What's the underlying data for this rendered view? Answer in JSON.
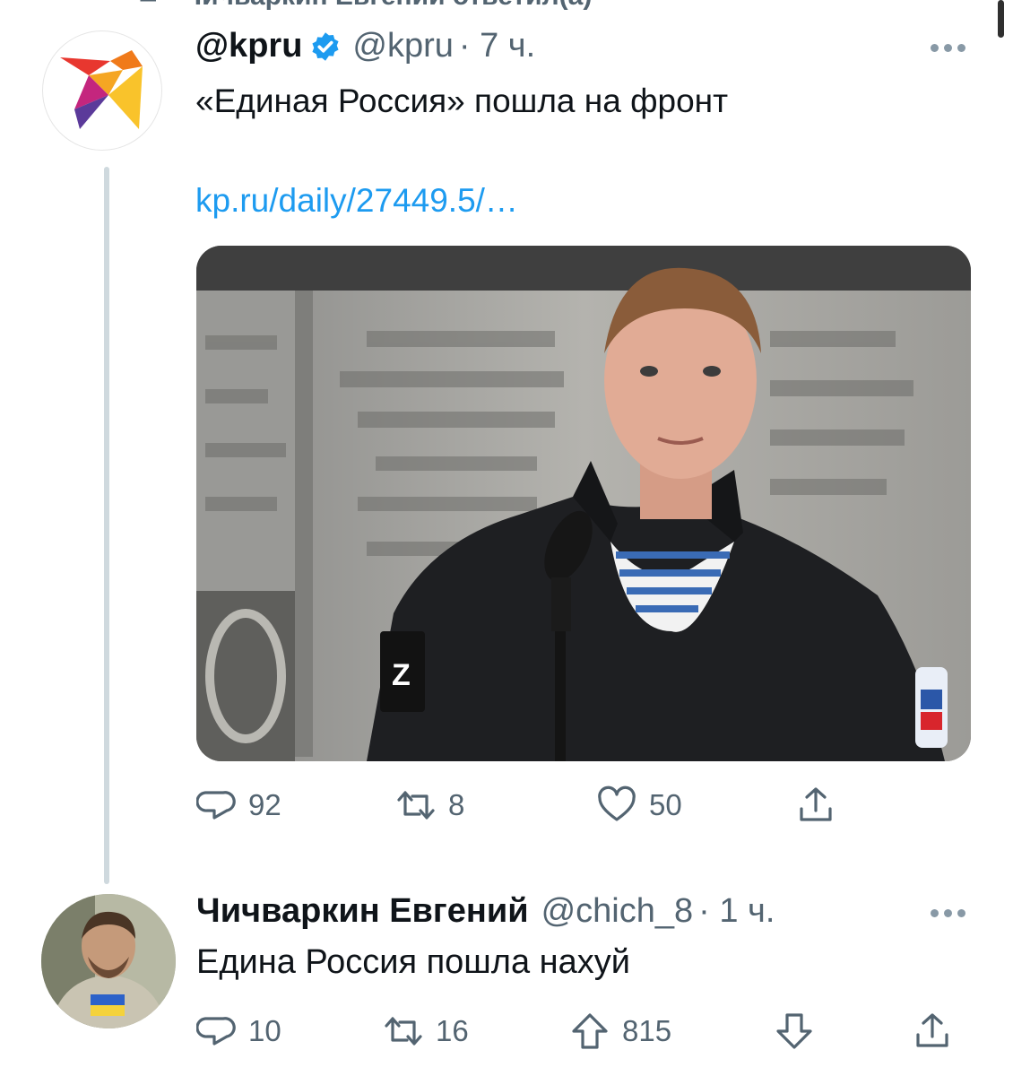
{
  "reply_header": {
    "text": "Чичваркин Евгений ответил(а)"
  },
  "tweets": [
    {
      "name": "@kpru",
      "handle": "@kpru",
      "time": "· 7 ч.",
      "text": "«Единая Россия» пошла на фронт",
      "link": "kp.ru/daily/27449.5/…",
      "stats": {
        "replies": "92",
        "retweets": "8",
        "likes": "50"
      }
    },
    {
      "name": "Чичваркин Евгений",
      "handle": "@chich_8",
      "time": "· 1 ч.",
      "text": "Едина Россия пошла нахуй",
      "stats": {
        "replies": "10",
        "retweets": "16",
        "upvotes": "815"
      }
    }
  ],
  "colors": {
    "link": "#1d9bf0",
    "muted": "#536471",
    "verified": "#1d9bf0"
  },
  "icons": [
    "retweet-icon",
    "verified-badge-icon",
    "more-icon",
    "reply-icon",
    "like-icon",
    "share-icon",
    "upvote-icon",
    "downvote-icon"
  ]
}
